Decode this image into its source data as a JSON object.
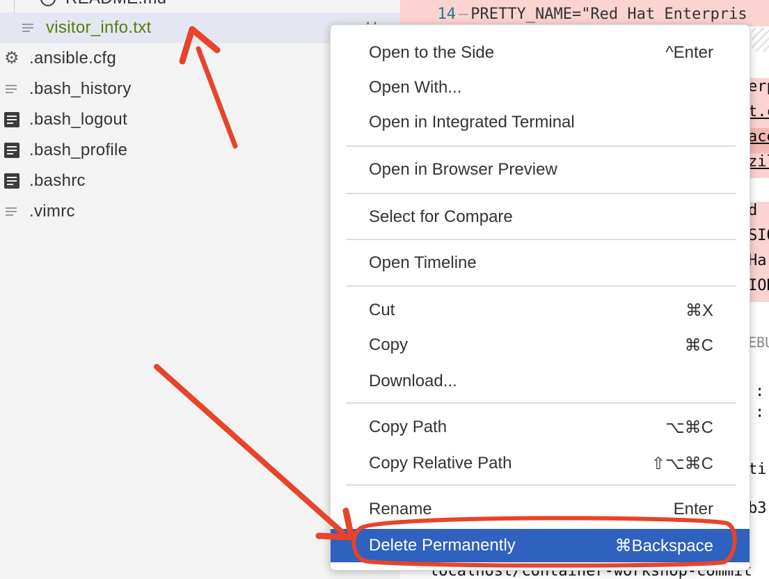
{
  "explorer": {
    "partial_top_item": "README.md",
    "items": [
      {
        "label": "visitor_info.txt",
        "icon": "lines-icon",
        "selected": true,
        "badge": "U",
        "color": "#587c0c"
      },
      {
        "label": ".ansible.cfg",
        "icon": "gear-icon"
      },
      {
        "label": ".bash_history",
        "icon": "lines-icon"
      },
      {
        "label": ".bash_logout",
        "icon": "doc-icon"
      },
      {
        "label": ".bash_profile",
        "icon": "doc-icon"
      },
      {
        "label": ".bashrc",
        "icon": "doc-icon"
      },
      {
        "label": ".vimrc",
        "icon": "lines-icon"
      }
    ]
  },
  "editor": {
    "line_number": "14",
    "line_text": "PRETTY_NAME=\"Red Hat Enterpris",
    "fragments": [
      "erp",
      "t.c",
      "ace",
      "zil",
      "d ",
      "SIO",
      " Ha",
      "ION",
      "EBU",
      ":",
      ":",
      "ti",
      "b3"
    ],
    "bottom_text": "localhost/container-workshop-commit"
  },
  "context_menu": {
    "items": [
      {
        "label": "Open to the Side",
        "shortcut": "^Enter"
      },
      {
        "label": "Open With...",
        "shortcut": ""
      },
      {
        "label": "Open in Integrated Terminal",
        "shortcut": ""
      },
      {
        "label": "Open in Browser Preview",
        "shortcut": ""
      },
      {
        "label": "Select for Compare",
        "shortcut": ""
      },
      {
        "label": "Open Timeline",
        "shortcut": ""
      },
      {
        "label": "Cut",
        "shortcut": "⌘X"
      },
      {
        "label": "Copy",
        "shortcut": "⌘C"
      },
      {
        "label": "Download...",
        "shortcut": ""
      },
      {
        "label": "Copy Path",
        "shortcut": "⌥⌘C"
      },
      {
        "label": "Copy Relative Path",
        "shortcut": "⇧⌥⌘C"
      },
      {
        "label": "Rename",
        "shortcut": "Enter"
      },
      {
        "label": "Delete Permanently",
        "shortcut": "⌘Backspace",
        "highlighted": true
      }
    ],
    "highlight_color": "#2f61bf"
  },
  "annotation_color": "#e8432b"
}
